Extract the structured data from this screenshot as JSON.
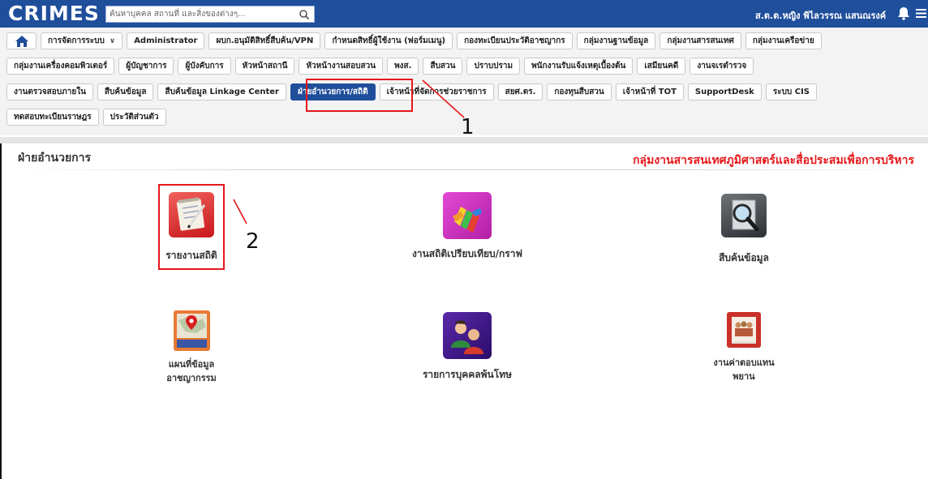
{
  "app": {
    "logo": "CRIMES",
    "search_placeholder": "ค้นหาบุคคล สถานที่ และสิ่งของต่างๆ...",
    "user_name": "ส.ต.ต.หญิง พิไลวรรณ แสนณรงค์"
  },
  "nav": {
    "rows": [
      [
        {
          "label": "",
          "icon": "home-icon"
        },
        {
          "label": "การจัดการระบบ",
          "dropdown": true
        },
        {
          "label": "Administrator"
        },
        {
          "label": "ผบก.อนุมัติสิทธิ์สืบค้น/VPN"
        },
        {
          "label": "กำหนดสิทธิ์ผู้ใช้งาน (ฟอร์มเมนู)"
        },
        {
          "label": "กองทะเบียนประวัติอาชญากร"
        },
        {
          "label": "กลุ่มงานฐานข้อมูล"
        },
        {
          "label": "กลุ่มงานสารสนเทศ"
        },
        {
          "label": "กลุ่มงานเครือข่าย"
        }
      ],
      [
        {
          "label": "กลุ่มงานเครื่องคอมพิวเตอร์"
        },
        {
          "label": "ผู้บัญชาการ"
        },
        {
          "label": "ผู้บังคับการ"
        },
        {
          "label": "หัวหน้าสถานี"
        },
        {
          "label": "หัวหน้างานสอบสวน"
        },
        {
          "label": "พงส."
        },
        {
          "label": "สืบสวน"
        },
        {
          "label": "ปราบปราม"
        },
        {
          "label": "พนักงานรับแจ้งเหตุเบื้องต้น"
        },
        {
          "label": "เสมียนคดี"
        },
        {
          "label": "งานจเรตำรวจ"
        }
      ],
      [
        {
          "label": "งานตรวจสอบภายใน"
        },
        {
          "label": "สืบค้นข้อมูล"
        },
        {
          "label": "สืบค้นข้อมูล Linkage Center"
        },
        {
          "label": "ฝ่ายอำนวยการ/สถิติ",
          "active": true
        },
        {
          "label": "เจ้าหน้าที่จัดการช่วยราชการ"
        },
        {
          "label": "สยศ.ตร."
        },
        {
          "label": "กองทุนสืบสวน"
        },
        {
          "label": "เจ้าหน้าที่ TOT"
        },
        {
          "label": "SupportDesk"
        },
        {
          "label": "ระบบ CIS"
        }
      ],
      [
        {
          "label": "ทดสอบทะเบียนราษฎร"
        },
        {
          "label": "ประวัติส่วนตัว"
        }
      ]
    ]
  },
  "annotations": [
    "1",
    "2"
  ],
  "section": {
    "title": "ฝ่ายอำนวยการ",
    "subtitle": "กลุ่มงานสารสนเทศภูมิศาสตร์และสื่อประสมเพื่อการบริหาร"
  },
  "tiles": [
    {
      "label": "รายงานสถิติ",
      "icon": "report-notepad-icon"
    },
    {
      "label": "งานสถิติเปรียบเทียบ/กราฟ",
      "icon": "statistics-graph-icon"
    },
    {
      "label": "สืบค้นข้อมูล",
      "icon": "magnifier-search-icon"
    },
    {
      "label": "แผนที่ข้อมูล",
      "label2": "อาชญากรรม",
      "icon": "crime-map-icon",
      "icon_caption": "ข้อมูลแผนที่อาชญากรรม"
    },
    {
      "label": "รายการบุคคลพ้นโทษ",
      "icon": "released-persons-icon"
    },
    {
      "label": "งานค่าตอบแทน",
      "label2": "พยาน",
      "icon": "witness-compensation-icon"
    }
  ],
  "colors": {
    "header_blue": "#1f4e9b",
    "annotation_red": "#e5171b",
    "subtitle_red": "#e5171b"
  }
}
